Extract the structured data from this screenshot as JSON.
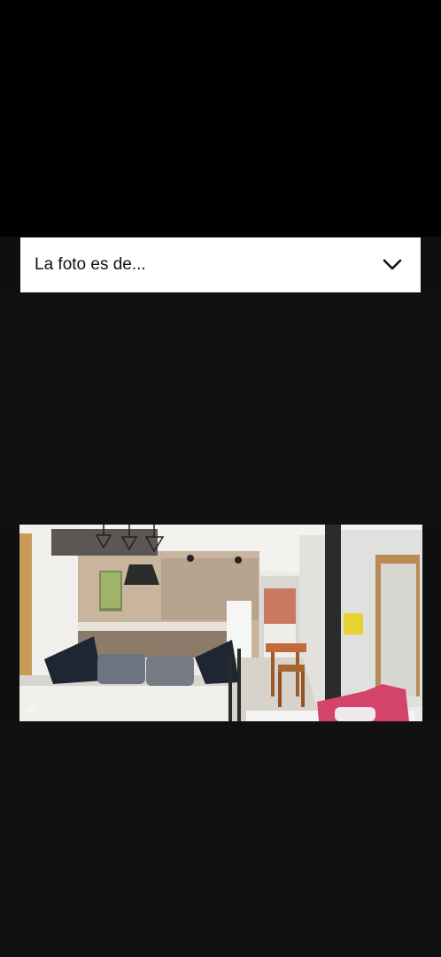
{
  "dropdown": {
    "label": "La foto es de...",
    "icon": "chevron-down-icon"
  },
  "photo": {
    "watermark": "☘ …",
    "colors": {
      "wall": "#ecebe6",
      "cabinet": "#8b7b68",
      "sofa": "#f1f0ec",
      "cushion_dark": "#1f2633",
      "cushion_pink": "#d4436a"
    }
  }
}
